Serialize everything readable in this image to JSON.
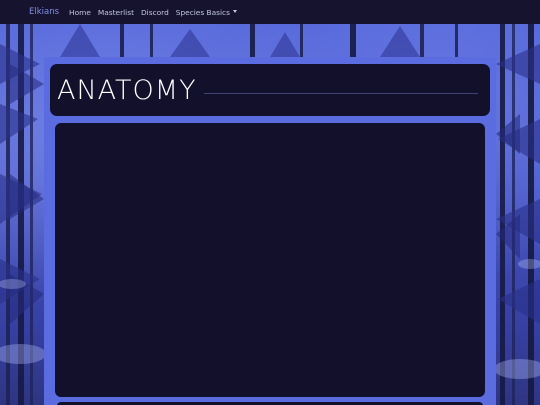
{
  "navbar": {
    "brand": "Elkians",
    "links": [
      "Home",
      "Masterlist",
      "Discord"
    ],
    "dropdown_label": "Species Basics",
    "dropdown_icon": "caret-down-icon"
  },
  "page": {
    "title": "ANATOMY"
  },
  "colors": {
    "navbar_bg": "#16132e",
    "brand": "#7f8fe9",
    "frame_accent": "#5a6ce0",
    "card_bg": "#12102b",
    "title_text": "#ffffff"
  }
}
